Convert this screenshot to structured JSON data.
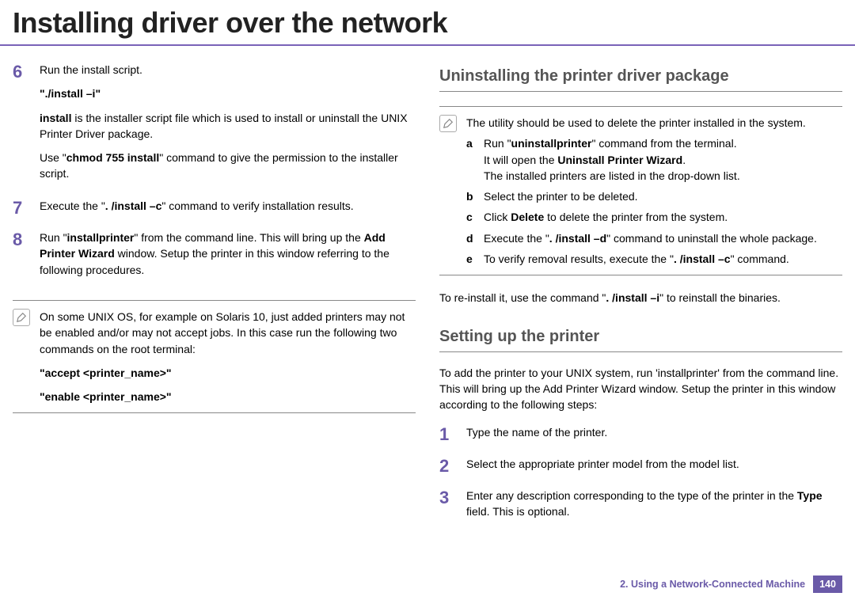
{
  "title": "Installing driver over the network",
  "left": {
    "step6": {
      "num": "6",
      "p1": "Run the install script.",
      "cmd": "\"./install –i\"",
      "p2a": "install",
      "p2b": " is the installer script file which is used to install or uninstall the UNIX Printer Driver package.",
      "p3a": "Use \"",
      "p3b": "chmod 755 install",
      "p3c": "\" command to give the permission to the installer script."
    },
    "step7": {
      "num": "7",
      "p1a": "Execute the \"",
      "p1b": ". /install –c",
      "p1c": "\" command to verify installation results."
    },
    "step8": {
      "num": "8",
      "p1a": "Run \"",
      "p1b": "installprinter",
      "p1c": "\" from the command line. This will bring up the ",
      "p1d": "Add Printer Wizard",
      "p1e": " window. Setup the printer in this window referring to the following procedures."
    },
    "note": {
      "p1": "On some UNIX OS, for example on Solaris 10, just added printers may not be enabled and/or may not accept jobs. In this case run the following two commands on the root terminal:",
      "cmd1": "\"accept <printer_name>\"",
      "cmd2": "\"enable <printer_name>\""
    }
  },
  "right": {
    "head1": "Uninstalling the printer driver package",
    "note": {
      "intro": "The utility should be used to delete the printer installed in the system.",
      "a1": "Run \"",
      "a2": "uninstallprinter",
      "a3": "\" command from the terminal.",
      "a4": "It will open the ",
      "a5": "Uninstall Printer Wizard",
      "a6": ".",
      "a7": "The installed printers are listed in the drop-down list.",
      "b": "Select the printer to be deleted.",
      "c1": "Click ",
      "c2": "Delete",
      "c3": " to delete the printer from the system.",
      "d1": "Execute the \"",
      "d2": ". /install –d",
      "d3": "\" command to uninstall the whole package.",
      "e1": "To verify removal results, execute the \"",
      "e2": ". /install –c",
      "e3": "\" command."
    },
    "reinstall1": "To re-install it, use the command \"",
    "reinstall2": ". /install –i",
    "reinstall3": "\" to reinstall the binaries.",
    "head2": "Setting up the printer",
    "setup_intro": "To add the printer to your UNIX system, run 'installprinter' from the command line. This will bring up the Add Printer Wizard window. Setup the printer in this window according to the following steps:",
    "s1": {
      "num": "1",
      "text": "Type the name of the printer."
    },
    "s2": {
      "num": "2",
      "text": "Select the appropriate printer model from the model list."
    },
    "s3": {
      "num": "3",
      "t1": "Enter any description corresponding to the type of the printer in the ",
      "t2": "Type",
      "t3": " field. This is optional."
    }
  },
  "footer": {
    "chapter": "2.  Using a Network-Connected Machine",
    "page": "140"
  }
}
